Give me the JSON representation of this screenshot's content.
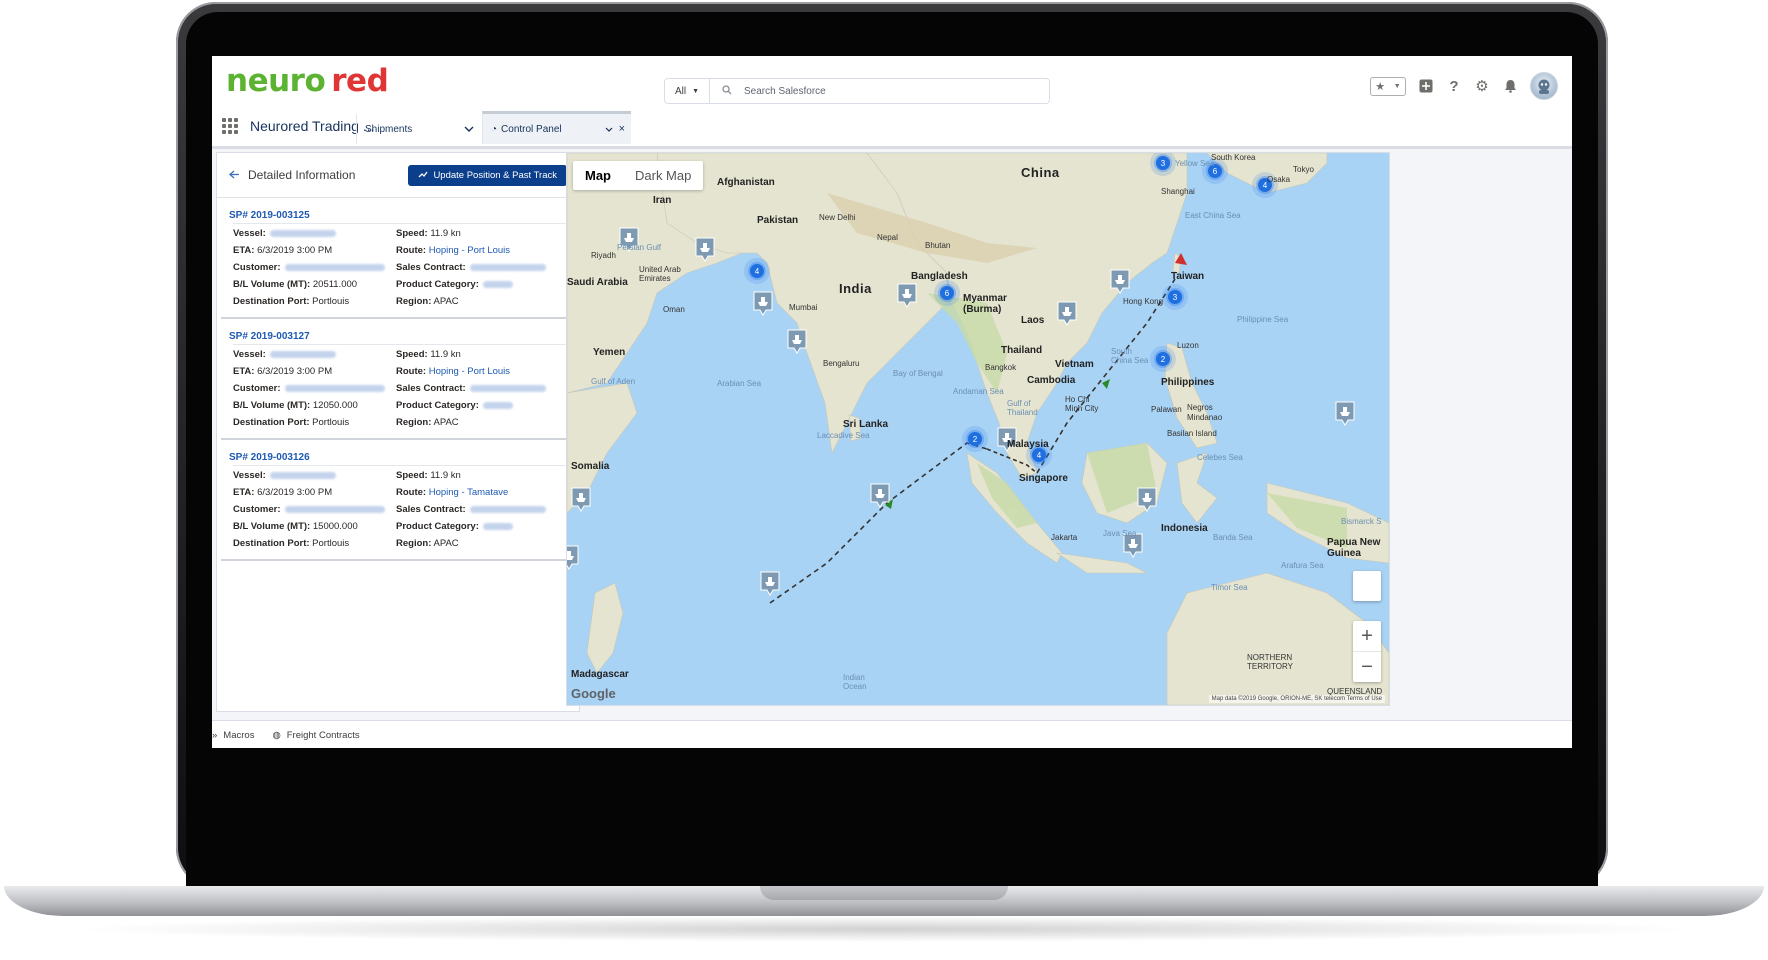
{
  "brand": {
    "logo_part1": "neuro",
    "logo_part2": "red",
    "color_green": "#5bb331",
    "color_red": "#e03535",
    "accent": "#0b3f8b"
  },
  "header": {
    "search_scope": "All",
    "search_placeholder": "Search Salesforce",
    "icons": [
      "favorites-star-icon",
      "favorites-chevron-icon",
      "global-add-icon",
      "help-icon",
      "setup-gear-icon",
      "notification-bell-icon",
      "user-avatar"
    ]
  },
  "nav": {
    "app_name": "Neurored Trading ...",
    "tab_objects": "Shipments",
    "tab_active": "Control Panel"
  },
  "panel": {
    "title": "Detailed Information",
    "update_button": "Update Position & Past Track",
    "labels": {
      "vessel": "Vessel:",
      "eta": "ETA:",
      "customer": "Customer:",
      "bl_volume": "B/L Volume (MT):",
      "destination_port": "Destination Port:",
      "speed": "Speed:",
      "route": "Route:",
      "sales_contract": "Sales Contract:",
      "product_category": "Product Category:",
      "region": "Region:"
    },
    "shipments": [
      {
        "id": "SP# 2019-003125",
        "eta": "6/3/2019 3:00 PM",
        "bl_volume": "20511.000",
        "destination_port": "Portlouis",
        "speed": "11.9 kn",
        "route": "Hoping - Port Louis",
        "region": "APAC"
      },
      {
        "id": "SP# 2019-003127",
        "eta": "6/3/2019 3:00 PM",
        "bl_volume": "12050.000",
        "destination_port": "Portlouis",
        "speed": "11.9 kn",
        "route": "Hoping - Port Louis",
        "region": "APAC"
      },
      {
        "id": "SP# 2019-003126",
        "eta": "6/3/2019 3:00 PM",
        "bl_volume": "15000.000",
        "destination_port": "Portlouis",
        "speed": "11.9 kn",
        "route": "Hoping - Tamatave",
        "region": "APAC"
      }
    ]
  },
  "map": {
    "toggle_map": "Map",
    "toggle_dark": "Dark Map",
    "labels": {
      "afghanistan": "Afghanistan",
      "iran": "Iran",
      "pakistan": "Pakistan",
      "new_delhi": "New Delhi",
      "nepal": "Nepal",
      "bhutan": "Bhutan",
      "china": "China",
      "india": "India",
      "bangladesh": "Bangladesh",
      "myanmar": "Myanmar\n(Burma)",
      "laos": "Laos",
      "thailand": "Thailand",
      "vietnam": "Vietnam",
      "cambodia": "Cambodia",
      "malaysia": "Malaysia",
      "singapore": "Singapore",
      "indonesia": "Indonesia",
      "philippines": "Philippines",
      "taiwan": "Taiwan",
      "south_korea": "South Korea",
      "tokyo": "Tokyo",
      "oman": "Oman",
      "yemen": "Yemen",
      "saudi_arabia": "Saudi Arabia",
      "riyadh": "Riyadh",
      "uae": "United Arab\nEmirates",
      "mumbai": "Mumbai",
      "bengaluru": "Bengaluru",
      "sri_lanka": "Sri Lanka",
      "somalia": "Somalia",
      "madagascar": "Madagascar",
      "papua": "Papua New\nGuinea",
      "hong_kong": "Hong Kong",
      "shanghai": "Shanghai",
      "manila": "Luzon",
      "kuala_lumpur": "Ho Chi\nMinh City",
      "bangkok": "Bangkok",
      "jakarta": "Jakarta",
      "palawan": "Palawan",
      "negros": "Negros",
      "mindanao": "Mindanao",
      "basilan": "Basilan Island",
      "northern_territory": "NORTHERN\nTERRITORY",
      "queensland": "QUEENSLAND",
      "osaka": "Osaka"
    },
    "seas": {
      "arabian": "Arabian Sea",
      "bay_bengal": "Bay of Bengal",
      "andaman": "Andaman Sea",
      "gulf_thailand": "Gulf of\nThailand",
      "south_china": "South\nChina Sea",
      "philippine": "Philippine Sea",
      "east_china": "East China Sea",
      "yellow": "Yellow Sea",
      "celebes": "Celebes Sea",
      "java": "Java Sea",
      "banda": "Banda Sea",
      "arafura": "Arafura Sea",
      "timor": "Timor Sea",
      "laccadive": "Laccadive Sea",
      "gulf_aden": "Gulf of Aden",
      "indian_ocean": "Indian\nOcean",
      "persian": "Persian Gulf",
      "bismarck": "Bismarck S"
    },
    "cluster_counts": [
      "3",
      "6",
      "4",
      "4",
      "6",
      "3",
      "2",
      "2",
      "4"
    ],
    "google": "Google",
    "attribution": "Map data ©2019 Google, ORION-ME, SK telecom   Terms of Use",
    "zoom_in": "+",
    "zoom_out": "−"
  },
  "footer": {
    "macros": "Macros",
    "freight_contracts": "Freight Contracts"
  }
}
